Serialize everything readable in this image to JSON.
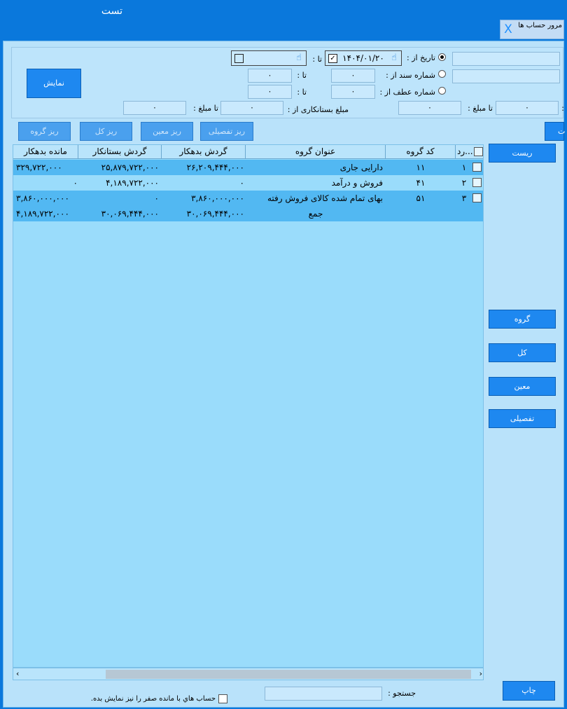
{
  "window": {
    "title": "تست",
    "tab_label": "مرور حساب ها",
    "close_glyph": "X"
  },
  "filters": {
    "date_label": "تاریخ از :",
    "date_value": "۱۴۰۴/۰۱/۲۰",
    "to_label": "تا :",
    "doc_no_label": "شماره سند از :",
    "doc_no_from": "۰",
    "doc_no_to": "۰",
    "atf_no_label": "شماره عطف از :",
    "atf_no_from": "۰",
    "atf_no_to": "۰",
    "creditor_amount_label": "مبلغ بستانکاری از :",
    "creditor_from": "۰",
    "creditor_to": "۰",
    "to_amount_label": "تا مبلغ :",
    "debtor_from": "۰",
    "debtor_to": "۰",
    "colon": ":"
  },
  "buttons": {
    "show": "نمایش",
    "reset": "ریست",
    "group": "گروه",
    "kol": "کل",
    "moein": "معین",
    "tafsili": "تفصیلی",
    "print": "چاپ",
    "sub_group": "ریز گروه",
    "sub_kol": "ریز کل",
    "sub_moein": "ریز معین",
    "sub_tafsili": "ریز تفصیلی",
    "edge": "ت"
  },
  "table": {
    "headers": {
      "row": "رد...",
      "code": "کد گروه",
      "title": "عنوان گروه",
      "debit": "گردش بدهکار",
      "credit": "گردش بستانکار",
      "balance": "مانده بدهکار"
    },
    "rows": [
      {
        "row": "۱",
        "code": "۱۱",
        "title": "دارایی جاری",
        "debit": "۲۶,۲۰۹,۴۴۴,۰۰۰",
        "credit": "۲۵,۸۷۹,۷۲۲,۰۰۰",
        "balance": "۳۲۹,۷۲۲,۰۰۰"
      },
      {
        "row": "۲",
        "code": "۴۱",
        "title": "فروش و درآمد",
        "debit": "۰",
        "credit": "۴,۱۸۹,۷۲۲,۰۰۰",
        "balance": "۰"
      },
      {
        "row": "۳",
        "code": "۵۱",
        "title": "بهای تمام شده کالای فروش رفته",
        "debit": "۳,۸۶۰,۰۰۰,۰۰۰",
        "credit": "۰",
        "balance": "۳,۸۶۰,۰۰۰,۰۰۰"
      }
    ],
    "total": {
      "title": "جمع",
      "debit": "۳۰,۰۶۹,۴۴۴,۰۰۰",
      "credit": "۳۰,۰۶۹,۴۴۴,۰۰۰",
      "balance": "۴,۱۸۹,۷۲۲,۰۰۰"
    }
  },
  "footer": {
    "search_label": "جستجو :",
    "search_value": "",
    "zero_balance_label": "حساب هاي با مانده صفر را نيز نمايش بده."
  },
  "colors": {
    "accent": "#0a78dc",
    "panel": "#b9e2fa",
    "grid": "#9adcfb",
    "selected_row": "#52b8f2"
  }
}
